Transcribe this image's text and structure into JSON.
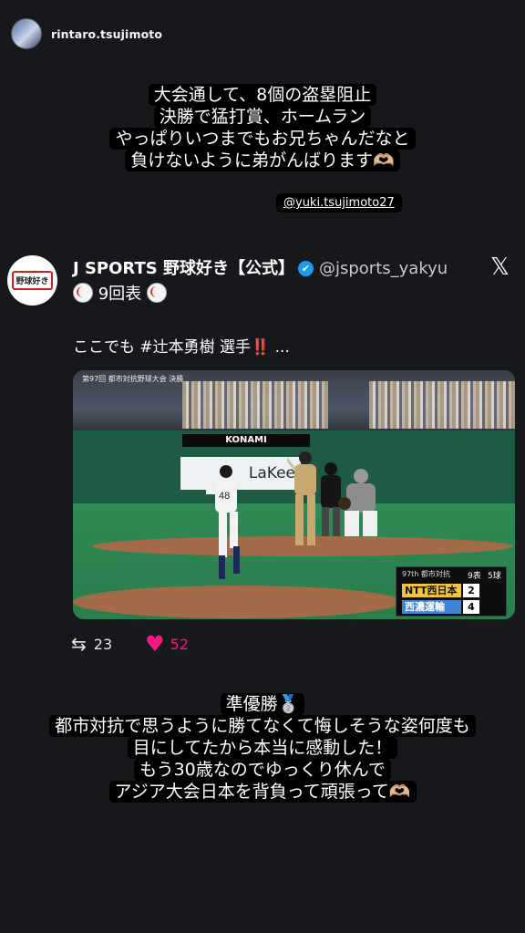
{
  "story": {
    "username": "rintaro.tsujimoto",
    "caption_top": [
      "大会通して、8個の盗塁阻止",
      "決勝で猛打賞、ホームラン",
      "やっぱりいつまでもお兄ちゃんだなと",
      "負けないように弟がんばります🫶🏼"
    ],
    "mention": "@yuki.tsujimoto27",
    "caption_bottom": [
      "準優勝🥈",
      "都市対抗で思うように勝てなくて悔しそうな姿何度も",
      "目にしてたから本当に感動した！",
      "もう30歳なのでゆっくり休んで",
      "アジア大会日本を背負って頑張って🫶🏼"
    ]
  },
  "post": {
    "avatar_text": "野球好き",
    "name": "J SPORTS 野球好き【公式】",
    "handle": "@jsports_yakyu",
    "x_logo": "𝕏",
    "inning_text": "9回表",
    "body_prefix": "ここでも ",
    "hashtag": "#辻本勇樹",
    "body_suffix": " 選手",
    "exclaim": "‼️",
    "ellipsis": " ...",
    "retweets": "23",
    "likes": "52"
  },
  "video": {
    "board_title": "第97回 都市対抗野球大会 決勝",
    "konami": "KONAMI",
    "ad_text": "LaKee",
    "scoreboard_header": "97th 都市対抗",
    "inning": "9表",
    "outs": "5球",
    "team1": "NTT西日本",
    "score1": "2",
    "team2": "西濃運輸",
    "score2": "4",
    "pitch_count": "5"
  },
  "icons": {
    "retweet": "retweet-icon",
    "heart": "heart-icon",
    "verified": "verified-badge-icon",
    "baseball": "baseball-icon",
    "x": "x-logo-icon"
  }
}
